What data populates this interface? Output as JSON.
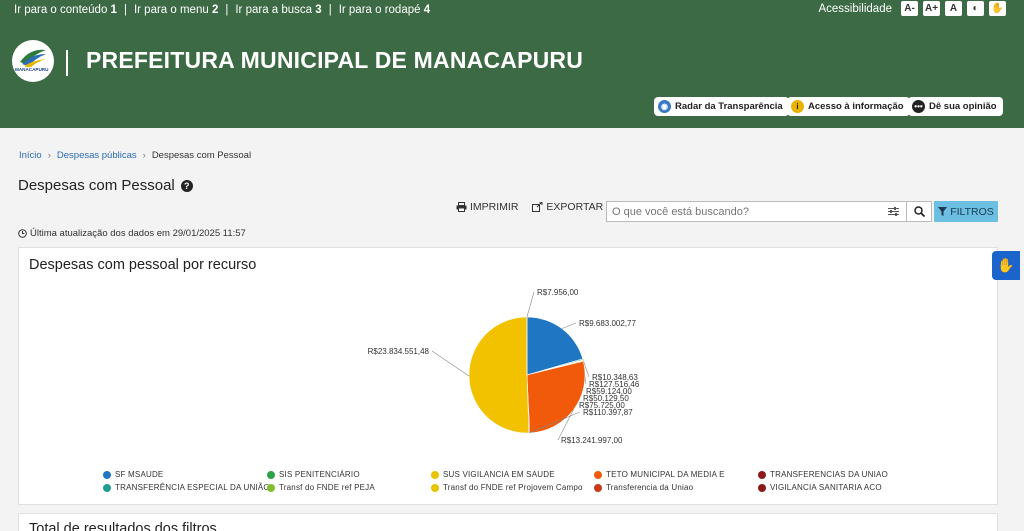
{
  "skip_links": [
    {
      "label": "Ir para o conteúdo",
      "key": "1"
    },
    {
      "label": "Ir para o menu",
      "key": "2"
    },
    {
      "label": "Ir para a busca",
      "key": "3"
    },
    {
      "label": "Ir para o rodapé",
      "key": "4"
    }
  ],
  "accessibility": {
    "label": "Acessibilidade",
    "buttons": [
      "A-",
      "A+",
      "A",
      "◐",
      "✋"
    ]
  },
  "header": {
    "logo_text": "MANACAPURU",
    "title": "PREFEITURA MUNICIPAL DE MANACAPURU",
    "buttons": [
      {
        "label": "Radar da Transparência",
        "icon": "radar-icon",
        "color": "#3a78c8"
      },
      {
        "label": "Acesso à informação",
        "icon": "info-icon",
        "color": "#e8b400"
      },
      {
        "label": "Dê sua opinião",
        "icon": "chat-icon",
        "color": "#222222"
      }
    ]
  },
  "breadcrumb": {
    "items": [
      "Início",
      "Despesas públicas",
      "Despesas com Pessoal"
    ]
  },
  "page": {
    "title": "Despesas com Pessoal",
    "help_icon": "question-circle-icon",
    "print_label": "IMPRIMIR",
    "export_label": "EXPORTAR",
    "search_placeholder": "O que você está buscando?",
    "filters_label": "FILTROS",
    "updated": "Última atualização dos dados em 29/01/2025 11:57"
  },
  "chart_card": {
    "title": "Despesas com pessoal por recurso"
  },
  "chart_data": {
    "type": "pie",
    "title": "Despesas com pessoal por recurso",
    "slices": [
      {
        "label": "SF MSAUDE",
        "value": 9683002.77,
        "display": "R$9.683.002,77",
        "color": "#1f77c4"
      },
      {
        "label": "TRANSFERÊNCIA ESPECIAL DA UNIÃO",
        "value": 10348.63,
        "display": "R$10.348,63",
        "color": "#1f9e8f"
      },
      {
        "label": "SIS PENITENCIÁRIO",
        "value": 127516.46,
        "display": "R$127.516,46",
        "color": "#2ca24a"
      },
      {
        "label": "Transf do FNDE ref PEJA",
        "value": 59124.0,
        "display": "R$59.124,00",
        "color": "#7fbf2a"
      },
      {
        "label": "SUS VIGILANCIA EM SAUDE",
        "value": 50129.5,
        "display": "R$50.129,50",
        "color": "#d6c200"
      },
      {
        "label": "Transf do FNDE ref Projovem Campo",
        "value": 75725.0,
        "display": "R$75.725,00",
        "color": "#e0b400"
      },
      {
        "label": "TETO MUNICIPAL DA MEDIA E",
        "value": 13241997.0,
        "display": "R$13.241.997,00",
        "color": "#f05a0a"
      },
      {
        "label": "Transferencia da Uniao",
        "value": 110397.87,
        "display": "R$110.397,87",
        "color": "#c83a1a"
      },
      {
        "label": "TRANSFERENCIAS DA UNIAO",
        "value": 23834551.48,
        "display": "R$23.834.551,48",
        "color": "#f2c200"
      },
      {
        "label": "VIGILANCIA SANITARIA ACO",
        "value": 7956.0,
        "display": "R$7.956,00",
        "color": "#8b1a1a"
      }
    ],
    "legend": [
      {
        "label": "SF MSAUDE",
        "color": "#1f77c4"
      },
      {
        "label": "SIS PENITENCIÁRIO",
        "color": "#2ca24a"
      },
      {
        "label": "SUS VIGILANCIA EM SAUDE",
        "color": "#e8c400"
      },
      {
        "label": "TETO MUNICIPAL DA MEDIA E",
        "color": "#f05a0a"
      },
      {
        "label": "TRANSFERENCIAS DA UNIAO",
        "color": "#8b1a1a"
      },
      {
        "label": "TRANSFERÊNCIA ESPECIAL DA UNIÃO",
        "color": "#1f9e8f"
      },
      {
        "label": "Transf do FNDE ref PEJA",
        "color": "#7fbf2a"
      },
      {
        "label": "Transf do FNDE ref Projovem Campo",
        "color": "#e8c400"
      },
      {
        "label": "Transferencia da Uniao",
        "color": "#c83a1a"
      },
      {
        "label": "VIGILANCIA SANITARIA ACO",
        "color": "#8b1a1a"
      }
    ],
    "legend_placement": "bottom"
  },
  "results_card": {
    "title": "Total de resultados dos filtros"
  }
}
